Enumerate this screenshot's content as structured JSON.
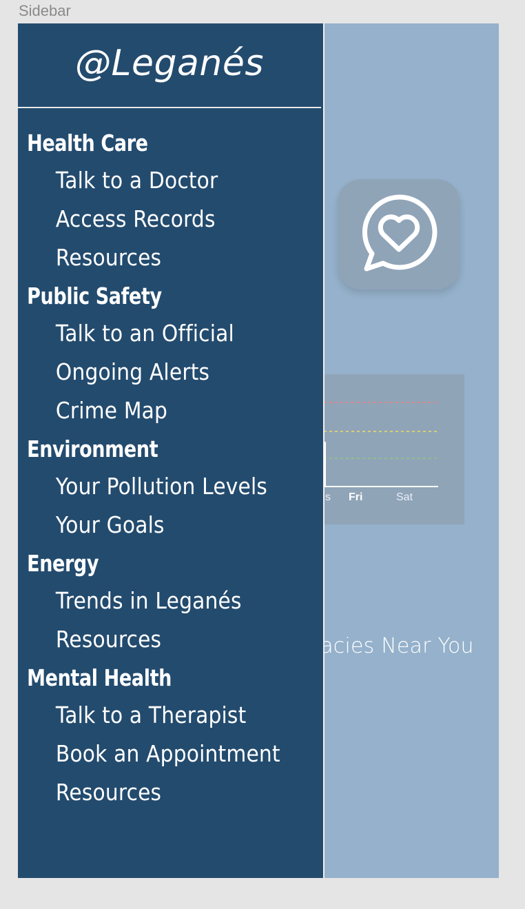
{
  "frame_label": "Sidebar",
  "sidebar": {
    "title": "@Leganés",
    "sections": [
      {
        "heading": "Health Care",
        "items": [
          "Talk to a Doctor",
          "Access Records",
          "Resources"
        ]
      },
      {
        "heading": "Public Safety",
        "items": [
          "Talk to an Official",
          "Ongoing Alerts",
          "Crime Map"
        ]
      },
      {
        "heading": "Environment",
        "items": [
          "Your Pollution Levels",
          "Your Goals"
        ]
      },
      {
        "heading": "Energy",
        "items": [
          "Trends in Leganés",
          "Resources"
        ]
      },
      {
        "heading": "Mental Health",
        "items": [
          "Talk to a Therapist",
          "Book an Appointment",
          "Resources"
        ]
      }
    ]
  },
  "background": {
    "chart_days": [
      "s",
      "Fri",
      "Sat"
    ],
    "pharmacies_text": "nacies Near You",
    "fragment_1": "e",
    "fragment_2": "e"
  },
  "colors": {
    "sidebar_bg": "#234b6e",
    "frame_bg": "#95b1cb",
    "card_bg": "#90a4b8",
    "line_red": "#d98a8a",
    "line_yellow": "#d9cf74",
    "line_green": "#8fbf8a"
  },
  "icons": {
    "app_icon": "heart-chat-bubble-icon"
  }
}
